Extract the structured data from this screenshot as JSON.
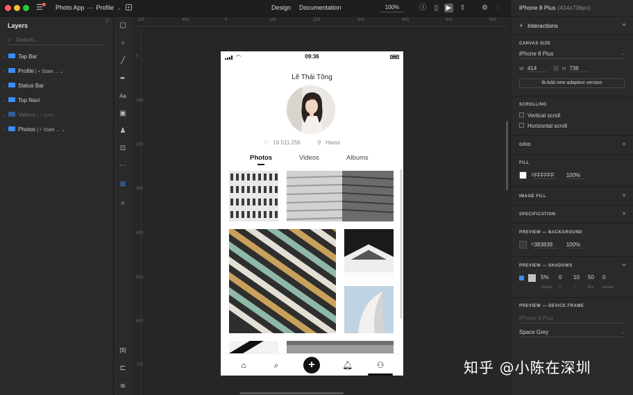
{
  "app": {
    "name": "Photo App",
    "crumb_sep": "—",
    "page": "Profile",
    "tabs": {
      "design": "Design",
      "documentation": "Documentation"
    },
    "zoom": "100%"
  },
  "layers": {
    "title": "Layers",
    "search_placeholder": "Search...",
    "items": [
      {
        "label": "Tap Bar",
        "state": ""
      },
      {
        "label": "Profile",
        "state": "| ⁍ State ... ⌄"
      },
      {
        "label": "Status Bar",
        "state": ""
      },
      {
        "label": "Top Navi",
        "state": ""
      },
      {
        "label": "Videos",
        "state": "| ⁍ State"
      },
      {
        "label": "Photos",
        "state": "| ⁍ State ... ⌄"
      }
    ]
  },
  "ruler": {
    "top": [
      "200",
      "400",
      "0",
      "100",
      "200",
      "300",
      "400",
      "500",
      "600"
    ],
    "left": [
      "0",
      "100",
      "200",
      "300",
      "400",
      "500",
      "600",
      "700"
    ]
  },
  "phone": {
    "time": "09:36",
    "name": "Lê Thái Tông",
    "likes": "16 511 256",
    "location": "Hanoi",
    "tabs": [
      "Photos",
      "Videos",
      "Albums"
    ]
  },
  "inspector": {
    "device": "iPhone 8 Plus",
    "device_size": "(414x736px)",
    "interactions": "Interactions",
    "canvas_size_label": "CANVAS SIZE",
    "canvas_device": "iPhone 8 Plus",
    "w_label": "W",
    "w_value": "414",
    "h_label": "H",
    "h_value": "736",
    "adaptive_button": "Add new adaptive version",
    "scrolling_label": "SCROLLING",
    "vertical_scroll": "Vertical scroll",
    "horizontal_scroll": "Horizontal scroll",
    "grid_label": "GRID",
    "fill_label": "FILL",
    "fill_hex": "FFFFFF",
    "fill_opacity": "100%",
    "image_fill_label": "IMAGE FILL",
    "specification_label": "SPECIFICATION",
    "preview_bg_label": "PREVIEW — BACKGROUND",
    "preview_bg_hex": "383838",
    "preview_bg_opacity": "100%",
    "preview_shadows_label": "PREVIEW — SHADOWS",
    "shadow_values": [
      "5%",
      "0",
      "10",
      "50",
      "0"
    ],
    "shadow_labels": [
      "Opacity",
      "X",
      "Y",
      "Blur",
      "Spread"
    ],
    "device_frame_label": "PREVIEW — DEVICE FRAME",
    "device_frame_device": "iPhone 8 Plus",
    "device_frame_color": "Space Grey"
  },
  "watermark": "知乎 @小陈在深圳",
  "colors": {
    "accent": "#3a8ef6",
    "canvas": "#262626",
    "panel": "#2a2a2a",
    "fill": "#FFFFFF",
    "preview_bg": "#383838"
  }
}
